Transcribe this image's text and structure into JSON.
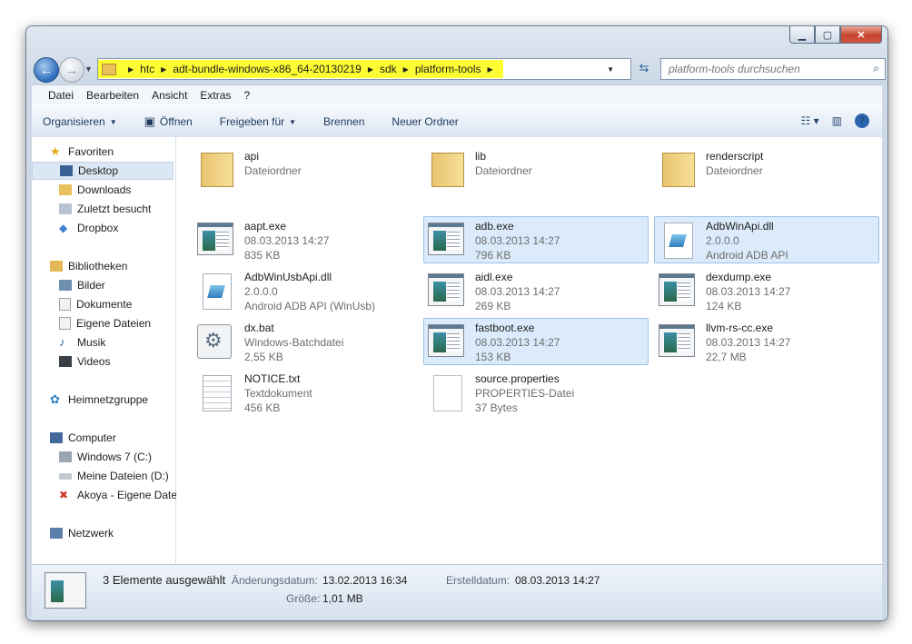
{
  "address": {
    "crumbs": [
      "htc",
      "adt-bundle-windows-x86_64-20130219",
      "sdk",
      "platform-tools"
    ],
    "highlight_color": "#fefc33"
  },
  "search": {
    "placeholder": "platform-tools durchsuchen"
  },
  "menu": [
    "Datei",
    "Bearbeiten",
    "Ansicht",
    "Extras",
    "?"
  ],
  "toolbar": {
    "organize": "Organisieren",
    "open": "Öffnen",
    "share": "Freigeben für",
    "burn": "Brennen",
    "new_folder": "Neuer Ordner"
  },
  "nav": {
    "favorites": "Favoriten",
    "desktop": "Desktop",
    "downloads": "Downloads",
    "recent": "Zuletzt besucht",
    "dropbox": "Dropbox",
    "libraries": "Bibliotheken",
    "pictures": "Bilder",
    "documents": "Dokumente",
    "my_files": "Eigene Dateien",
    "music": "Musik",
    "videos": "Videos",
    "homegroup": "Heimnetzgruppe",
    "computer": "Computer",
    "drive_c": "Windows 7 (C:)",
    "drive_d": "Meine Dateien (D:)",
    "drive_net": "Akoya - Eigene Date",
    "network": "Netzwerk"
  },
  "files": [
    {
      "name": "api",
      "line2": "Dateiordner",
      "line3": "",
      "icon": "folder-icon",
      "selected": false
    },
    {
      "name": "lib",
      "line2": "Dateiordner",
      "line3": "",
      "icon": "folder-icon",
      "selected": false
    },
    {
      "name": "renderscript",
      "line2": "Dateiordner",
      "line3": "",
      "icon": "folder-icon",
      "selected": false
    },
    {
      "name": "aapt.exe",
      "line2": "08.03.2013 14:27",
      "line3": "835 KB",
      "icon": "exe-icon",
      "selected": false
    },
    {
      "name": "adb.exe",
      "line2": "08.03.2013 14:27",
      "line3": "796 KB",
      "icon": "exe-icon",
      "selected": true
    },
    {
      "name": "AdbWinApi.dll",
      "line2": "2.0.0.0",
      "line3": "Android ADB API",
      "icon": "dll-icon",
      "selected": true
    },
    {
      "name": "AdbWinUsbApi.dll",
      "line2": "2.0.0.0",
      "line3": "Android ADB API (WinUsb)",
      "icon": "dll-icon",
      "selected": false
    },
    {
      "name": "aidl.exe",
      "line2": "08.03.2013 14:27",
      "line3": "269 KB",
      "icon": "exe-icon",
      "selected": false
    },
    {
      "name": "dexdump.exe",
      "line2": "08.03.2013 14:27",
      "line3": "124 KB",
      "icon": "exe-icon",
      "selected": false
    },
    {
      "name": "dx.bat",
      "line2": "Windows-Batchdatei",
      "line3": "2,55 KB",
      "icon": "batch-file-icon",
      "selected": false
    },
    {
      "name": "fastboot.exe",
      "line2": "08.03.2013 14:27",
      "line3": "153 KB",
      "icon": "exe-icon",
      "selected": true
    },
    {
      "name": "llvm-rs-cc.exe",
      "line2": "08.03.2013 14:27",
      "line3": "22,7 MB",
      "icon": "exe-icon",
      "selected": false
    },
    {
      "name": "NOTICE.txt",
      "line2": "Textdokument",
      "line3": "456 KB",
      "icon": "text-document-icon",
      "selected": false
    },
    {
      "name": "source.properties",
      "line2": "PROPERTIES-Datei",
      "line3": "37 Bytes",
      "icon": "file-icon",
      "selected": false
    }
  ],
  "status": {
    "selection": "3 Elemente ausgewählt",
    "modified_label": "Änderungsdatum:",
    "modified_value": "13.02.2013 16:34",
    "created_label": "Erstelldatum:",
    "created_value": "08.03.2013 14:27",
    "size_label": "Größe:",
    "size_value": "1,01 MB"
  }
}
